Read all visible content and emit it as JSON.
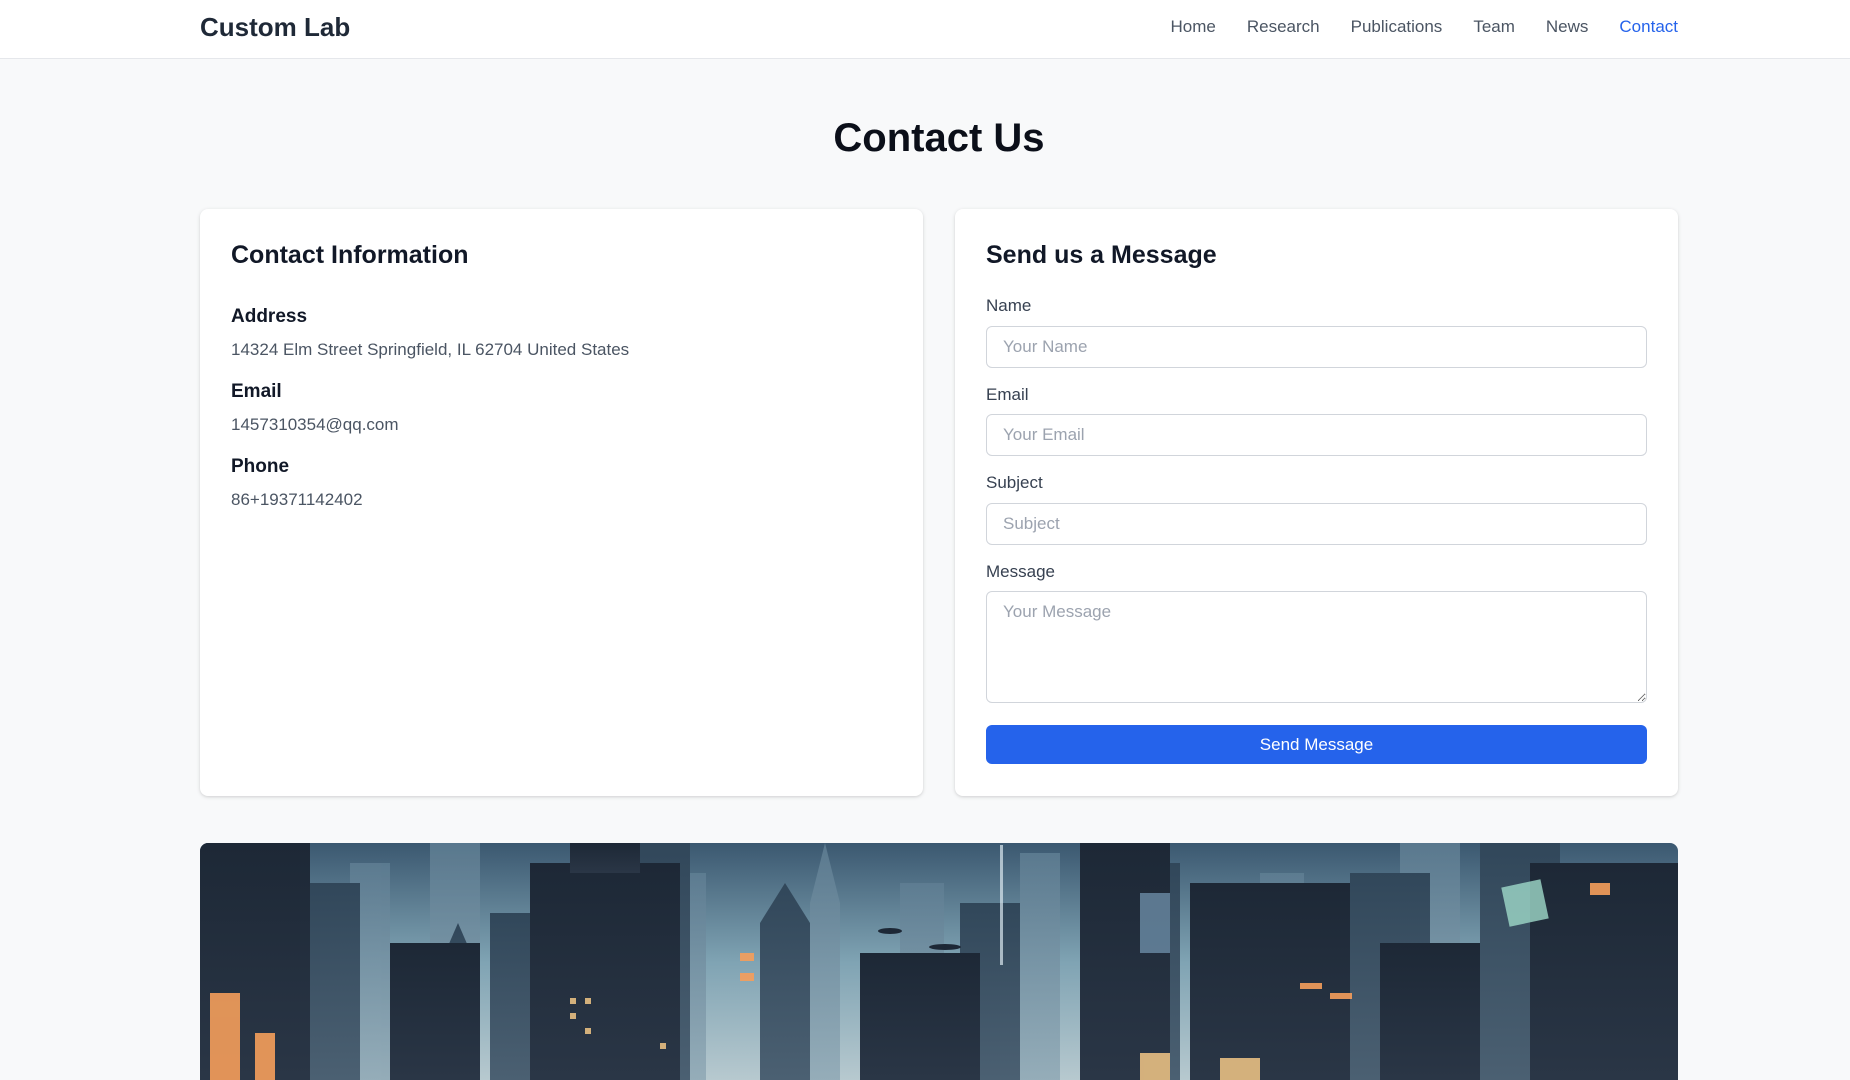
{
  "header": {
    "brand": "Custom Lab",
    "nav": [
      "Home",
      "Research",
      "Publications",
      "Team",
      "News",
      "Contact"
    ],
    "active": "Contact"
  },
  "page": {
    "title": "Contact Us"
  },
  "contact_info": {
    "heading": "Contact Information",
    "address_label": "Address",
    "address": "14324 Elm Street Springfield, IL 62704 United States",
    "email_label": "Email",
    "email": "1457310354@qq.com",
    "phone_label": "Phone",
    "phone": "86+19371142402"
  },
  "form": {
    "heading": "Send us a Message",
    "name_label": "Name",
    "name_placeholder": "Your Name",
    "email_label": "Email",
    "email_placeholder": "Your Email",
    "subject_label": "Subject",
    "subject_placeholder": "Subject",
    "message_label": "Message",
    "message_placeholder": "Your Message",
    "submit_label": "Send Message"
  },
  "colors": {
    "accent": "#2563eb",
    "background": "#f8f9fa",
    "card": "#ffffff"
  }
}
